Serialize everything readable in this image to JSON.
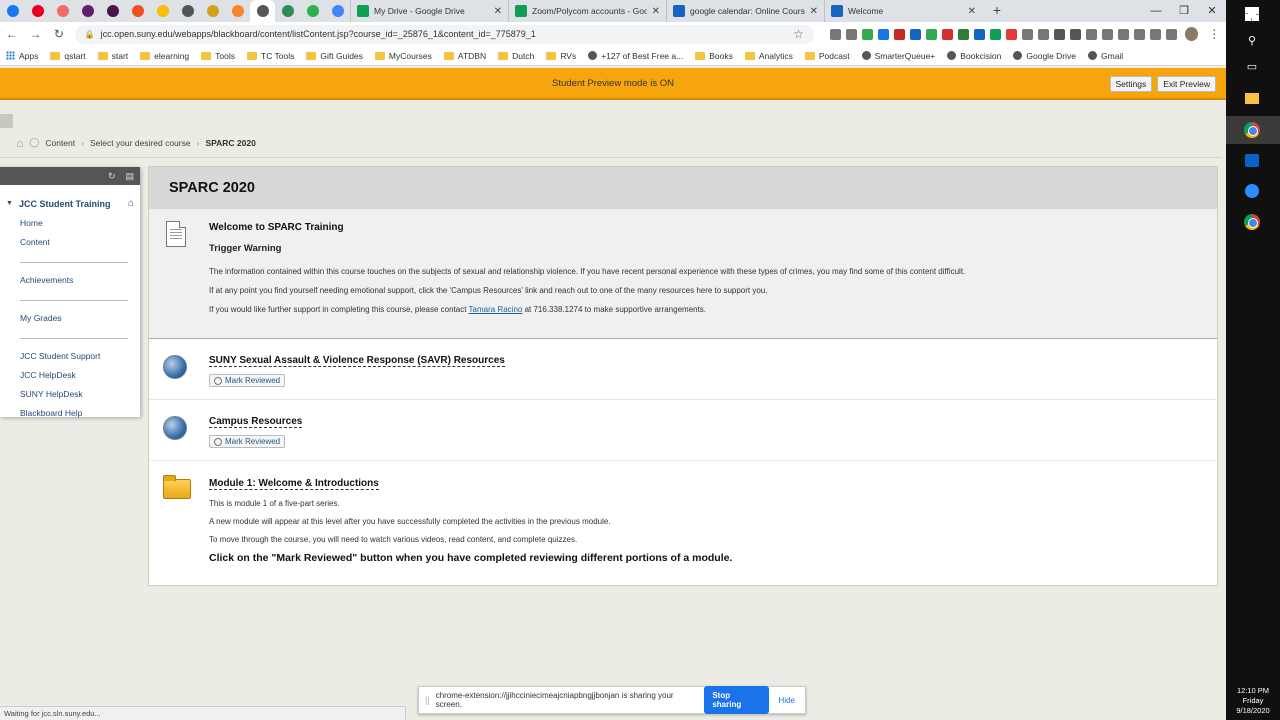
{
  "browser": {
    "pinned_tabs": [
      {
        "icon": "facebook-icon",
        "color": "#1877f2"
      },
      {
        "icon": "pinterest-icon",
        "color": "#e60023"
      },
      {
        "icon": "asana-icon",
        "color": "#f06a6a"
      },
      {
        "icon": "slack-icon",
        "color": "#611f69"
      },
      {
        "icon": "slack-icon",
        "color": "#4a154b"
      },
      {
        "icon": "microsoft-icon",
        "color": "#f25022"
      },
      {
        "icon": "keep-icon",
        "color": "#fbbc04"
      },
      {
        "icon": "wikipedia-icon",
        "color": "#555555"
      },
      {
        "icon": "blackboard-icon",
        "color": "#d4a017"
      },
      {
        "icon": "edpuzzle-icon",
        "color": "#f5882a"
      },
      {
        "icon": "chrome-active-icon",
        "color": "#555555"
      },
      {
        "icon": "screencastify-icon",
        "color": "#2e8b57"
      },
      {
        "icon": "feedly-icon",
        "color": "#2bb24c"
      },
      {
        "icon": "calendar-icon",
        "color": "#4285f4"
      }
    ],
    "tabs": [
      {
        "label": "My Drive - Google Drive",
        "icon": "drive-icon",
        "color": "#0f9d58"
      },
      {
        "label": "Zoom/Polycom accounts - Goog",
        "icon": "sheets-icon",
        "color": "#0f9d58"
      },
      {
        "label": "google calendar: Online Courses",
        "icon": "youtube-icon",
        "color": "#1565c0"
      },
      {
        "label": "Welcome",
        "icon": "youtube-icon",
        "color": "#1565c0"
      }
    ],
    "new_tab": "+",
    "window_controls": [
      "—",
      "❐",
      "✕"
    ],
    "nav": {
      "back": "←",
      "forward": "→",
      "reload": "↻"
    },
    "url": "jcc.open.suny.edu/webapps/blackboard/content/listContent.jsp?course_id=_25876_1&content_id=_775879_1",
    "bookmark_star": "☆",
    "extension_colors": [
      "#777777",
      "#777777",
      "#34a853",
      "#1a73e8",
      "#c62828",
      "#1565c0",
      "#34a853",
      "#d32f2f",
      "#2e7d32",
      "#1565c0",
      "#0f9d58",
      "#e53935",
      "#777777",
      "#777777",
      "#555555",
      "#555555",
      "#777777",
      "#777777",
      "#777777",
      "#777777",
      "#777777",
      "#777777"
    ],
    "menu": "⋮"
  },
  "bookmarks": [
    {
      "label": "Apps",
      "icon": "apps-icon"
    },
    {
      "label": "qstart",
      "icon": "folder-icon"
    },
    {
      "label": "start",
      "icon": "folder-icon"
    },
    {
      "label": "elearning",
      "icon": "folder-icon"
    },
    {
      "label": "Tools",
      "icon": "folder-icon"
    },
    {
      "label": "TC Tools",
      "icon": "folder-icon"
    },
    {
      "label": "Gift Guides",
      "icon": "folder-icon"
    },
    {
      "label": "MyCourses",
      "icon": "folder-icon"
    },
    {
      "label": "ATDBN",
      "icon": "folder-icon"
    },
    {
      "label": "Dutch",
      "icon": "folder-icon"
    },
    {
      "label": "RVs",
      "icon": "folder-icon"
    },
    {
      "label": "+127 of Best Free a...",
      "icon": "site-icon"
    },
    {
      "label": "Books",
      "icon": "folder-icon"
    },
    {
      "label": "Analytics",
      "icon": "folder-icon"
    },
    {
      "label": "Podcast",
      "icon": "folder-icon"
    },
    {
      "label": "SmarterQueue+",
      "icon": "site-icon"
    },
    {
      "label": "Bookcision",
      "icon": "site-icon"
    },
    {
      "label": "Google Drive",
      "icon": "drive-icon"
    },
    {
      "label": "Gmail",
      "icon": "gmail-icon"
    }
  ],
  "preview_banner": {
    "text": "Student Preview mode is ON",
    "settings_label": "Settings",
    "exit_label": "Exit Preview",
    "color": "#f7a50c"
  },
  "breadcrumb": {
    "items": [
      "Content",
      "Select your desired course"
    ],
    "current": "SPARC 2020",
    "separator": "›"
  },
  "course_menu": {
    "course_title": "JCC Student Training",
    "groups": [
      [
        "Home",
        "Content"
      ],
      [
        "Achievements"
      ],
      [
        "My Grades"
      ],
      [
        "JCC Student Support",
        "JCC HelpDesk",
        "SUNY HelpDesk",
        "Blackboard Help"
      ]
    ]
  },
  "content": {
    "page_title": "SPARC 2020",
    "welcome": {
      "title": "Welcome to SPARC Training",
      "subhead": "Trigger Warning",
      "p1": "The information contained within this course touches on the subjects of sexual and relationship violence. If you have recent personal experience with these types of crimes, you may find some of this content difficult.",
      "p2": "If at any point you find yourself needing emotional support, click the 'Campus Resources' link and reach out to one of the many resources here to support you.",
      "p3_before": "If you would like further support in completing this course, please contact ",
      "p3_link": "Tamara Racino",
      "p3_after": " at 716.338.1274 to make supportive arrangements."
    },
    "items": [
      {
        "title": "SUNY Sexual Assault & Violence Response (SAVR) Resources",
        "button": "Mark Reviewed"
      },
      {
        "title": "Campus Resources",
        "button": "Mark Reviewed"
      }
    ],
    "module": {
      "title": "Module 1: Welcome & Introductions",
      "lines": [
        "This is module 1 of a five-part series.",
        "A new module will appear at this level after you have successfully completed the activities in the previous module.",
        "To move through the course, you will need to watch various videos, read content, and complete quizzes."
      ],
      "bold": "Click on the \"Mark Reviewed\" button when you have completed reviewing different portions of a module."
    }
  },
  "share_bar": {
    "text": "chrome-extension://jjihcciniecimeajcniapbngjjbonjan is sharing your screen.",
    "stop_label": "Stop sharing",
    "hide_label": "Hide"
  },
  "status_text": "Waiting for jcc.sln.suny.edu...",
  "taskbar": {
    "time": "12:10 PM",
    "day": "Friday",
    "date": "9/18/2020"
  }
}
